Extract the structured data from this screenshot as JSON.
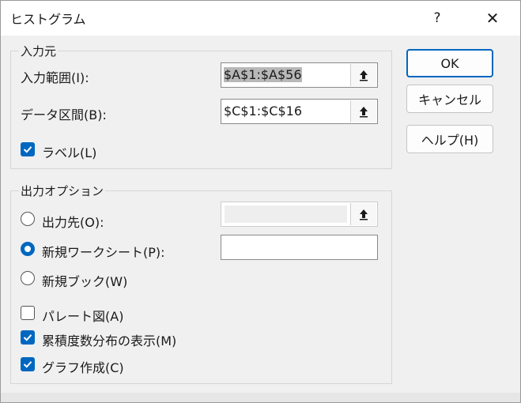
{
  "window": {
    "title": "ヒストグラム",
    "help": "?",
    "close": "✕"
  },
  "input_group": {
    "title": "入力元",
    "input_range": {
      "label": "入力範囲(I):",
      "value": "$A$1:$A$56"
    },
    "bin_range": {
      "label": "データ区間(B):",
      "value": "$C$1:$C$16"
    },
    "labels": {
      "label": "ラベル(L)",
      "checked": true
    }
  },
  "output_group": {
    "title": "出力オプション",
    "output_range": {
      "label": "出力先(O):",
      "selected": false,
      "value": ""
    },
    "new_sheet": {
      "label": "新規ワークシート(P):",
      "selected": true,
      "value": ""
    },
    "new_book": {
      "label": "新規ブック(W)",
      "selected": false
    },
    "pareto": {
      "label": "パレート図(A)",
      "checked": false
    },
    "cumulative": {
      "label": "累積度数分布の表示(M)",
      "checked": true
    },
    "chart": {
      "label": "グラフ作成(C)",
      "checked": true
    }
  },
  "buttons": {
    "ok": "OK",
    "cancel": "キャンセル",
    "help": "ヘルプ(H)"
  },
  "icons": {
    "collapse": "collapse-dialog-icon",
    "checkmark": "checkmark-icon"
  },
  "colors": {
    "accent": "#0067c0"
  }
}
